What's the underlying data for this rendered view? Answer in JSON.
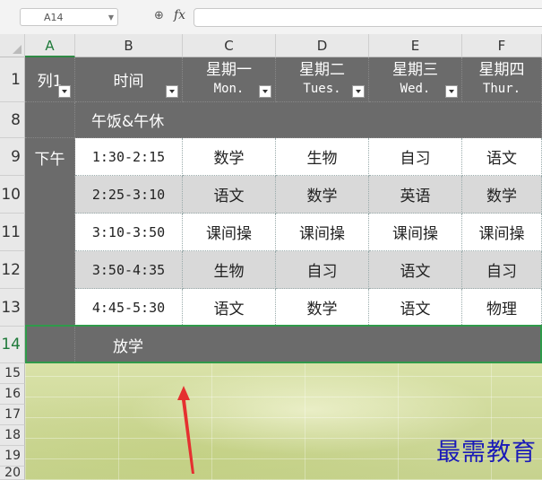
{
  "formula_bar": {
    "name_box": "A14",
    "fx_label": "fx",
    "formula_value": ""
  },
  "columns": [
    "A",
    "B",
    "C",
    "D",
    "E",
    "F"
  ],
  "header_row": {
    "row_number": "1",
    "a": "列1",
    "b": "时间",
    "c1": "星期一",
    "c2": "Mon.",
    "d1": "星期二",
    "d2": "Tues.",
    "e1": "星期三",
    "e2": "Wed.",
    "f1": "星期四",
    "f2": "Thur."
  },
  "rows": {
    "r8": {
      "num": "8",
      "b": "午饭&午休"
    },
    "r9": {
      "num": "9",
      "a": "下午",
      "b": "1:30-2:15",
      "c": "数学",
      "d": "生物",
      "e": "自习",
      "f": "语文"
    },
    "r10": {
      "num": "10",
      "b": "2:25-3:10",
      "c": "语文",
      "d": "数学",
      "e": "英语",
      "f": "数学"
    },
    "r11": {
      "num": "11",
      "b": "3:10-3:50",
      "c": "课间操",
      "d": "课间操",
      "e": "课间操",
      "f": "课间操"
    },
    "r12": {
      "num": "12",
      "b": "3:50-4:35",
      "c": "生物",
      "d": "自习",
      "e": "语文",
      "f": "自习"
    },
    "r13": {
      "num": "13",
      "b": "4:45-5:30",
      "c": "语文",
      "d": "数学",
      "e": "语文",
      "f": "物理"
    },
    "r14": {
      "num": "14",
      "b": "放学"
    }
  },
  "empty_rows": [
    "15",
    "16",
    "17",
    "18",
    "19",
    "20"
  ],
  "watermark": "最需教育",
  "colors": {
    "dark_fill": "#6b6b6b",
    "grey_fill": "#d9d9d9",
    "selection": "#2f9a4a",
    "arrow": "#e53030",
    "watermark": "#1a1ab8"
  }
}
